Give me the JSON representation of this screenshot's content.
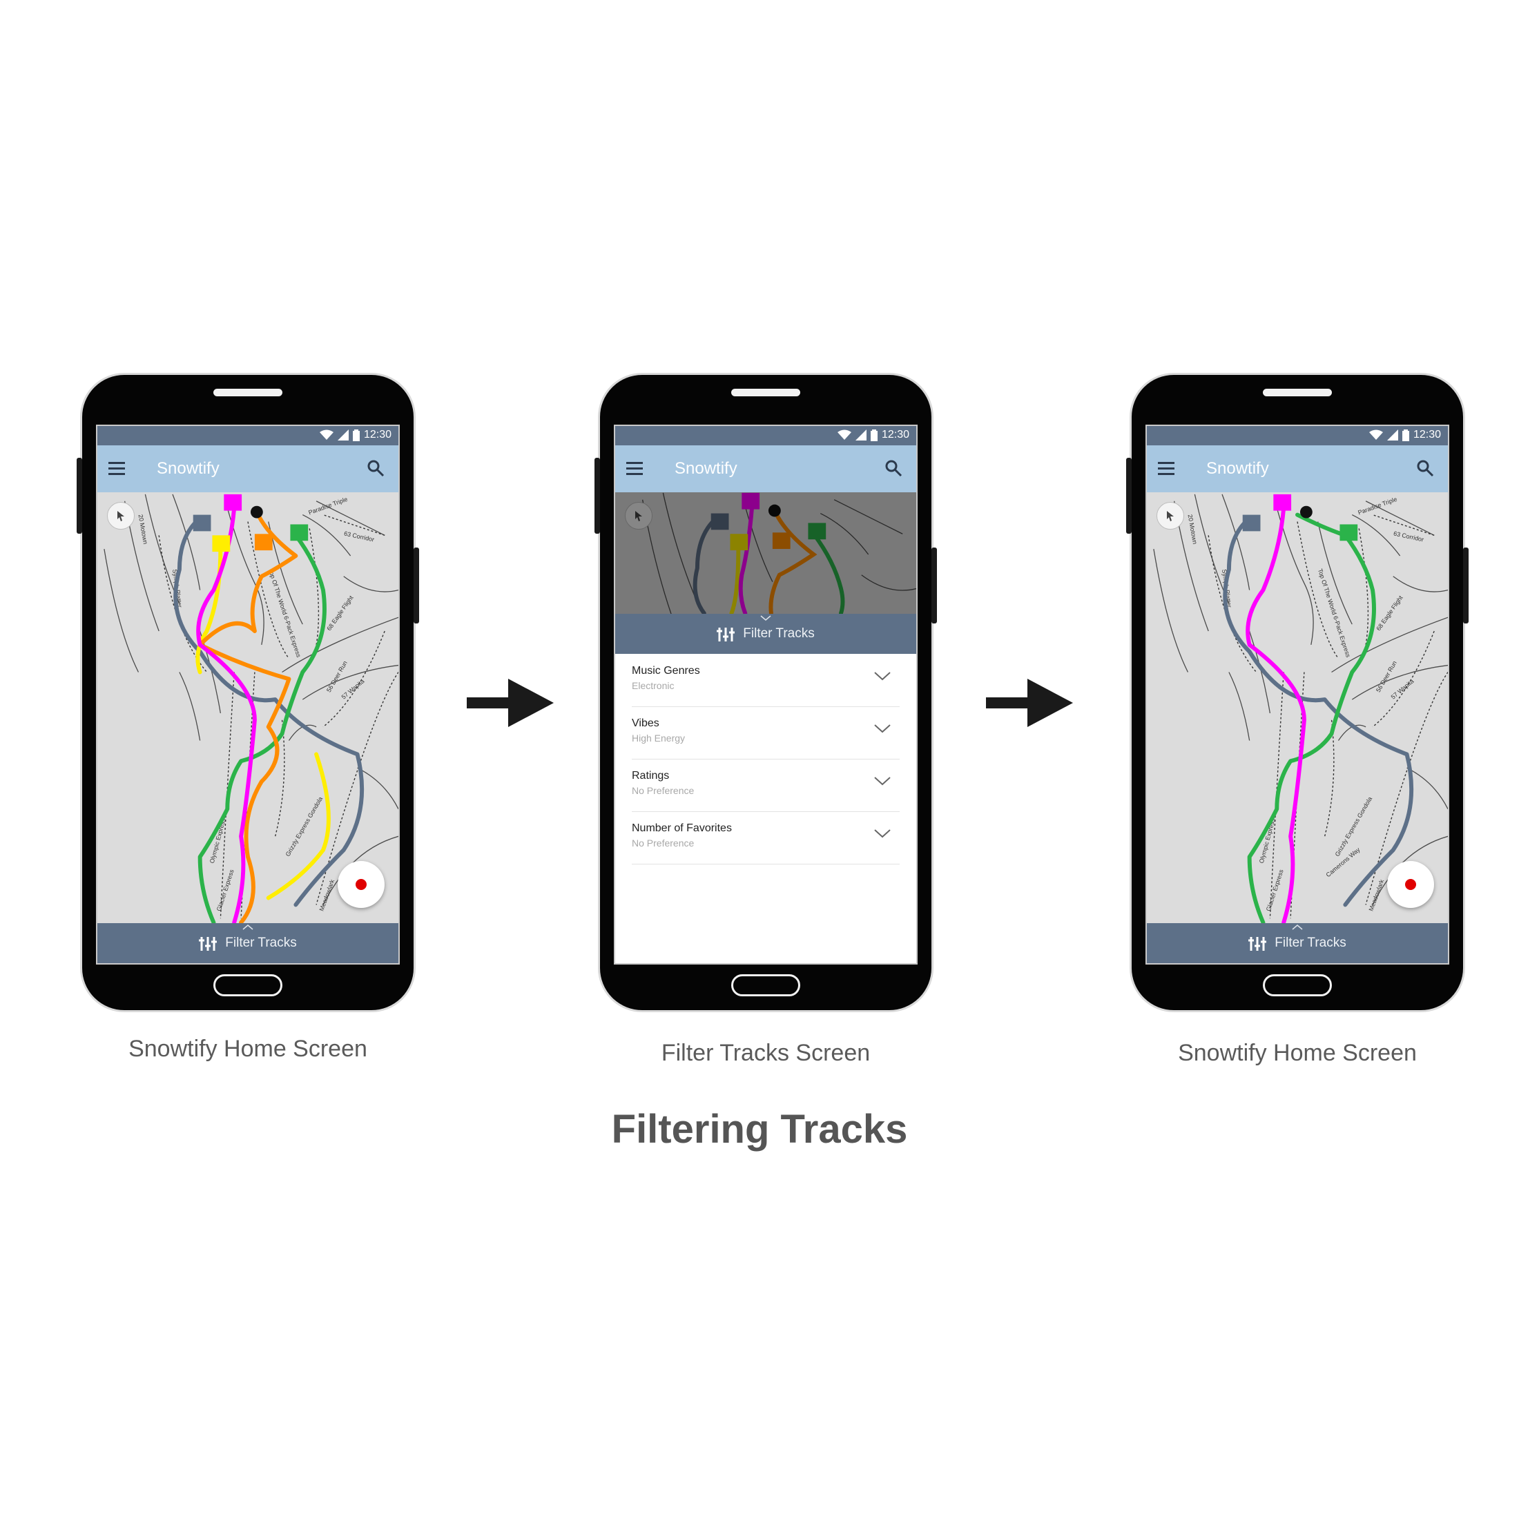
{
  "status": {
    "time": "12:30"
  },
  "app": {
    "title": "Snowtify"
  },
  "filter_bar": {
    "label": "Filter Tracks"
  },
  "filter_panel": {
    "items": [
      {
        "label": "Music Genres",
        "value": "Electronic"
      },
      {
        "label": "Vibes",
        "value": "High Energy"
      },
      {
        "label": "Ratings",
        "value": "No Preference"
      },
      {
        "label": "Number of Favorites",
        "value": "No Preference"
      }
    ]
  },
  "map_labels": {
    "paradise": "Paradise Triple",
    "corridor": "63 Corridor",
    "motown": "20 Motown",
    "platter": "Symph Platter",
    "top_world": "Top Of The World 6-Pack Express",
    "eagle": "68 Eagle Flight",
    "deer": "56 Deer Run",
    "wapita": "57 Wapita",
    "glacier": "Glacier Express",
    "olympic": "Olympic Express",
    "grizzly": "Grizzly Express Gondola",
    "camerons": "Camerons Way",
    "meadow": "Meadowlark"
  },
  "screens": [
    {
      "caption": "Snowtify Home Screen"
    },
    {
      "caption": "Filter Tracks Screen"
    },
    {
      "caption": "Snowtify Home Screen"
    }
  ],
  "page": {
    "title": "Filtering Tracks"
  },
  "colors": {
    "status_bar": "#5d7088",
    "app_bar": "#a7c7e1",
    "filter_bar": "#5d7088",
    "track_magenta": "#ff00ff",
    "track_yellow": "#ffee00",
    "track_orange": "#ff8c00",
    "track_green": "#2bb34a",
    "track_slate": "#5d7088",
    "record": "#e00000"
  }
}
